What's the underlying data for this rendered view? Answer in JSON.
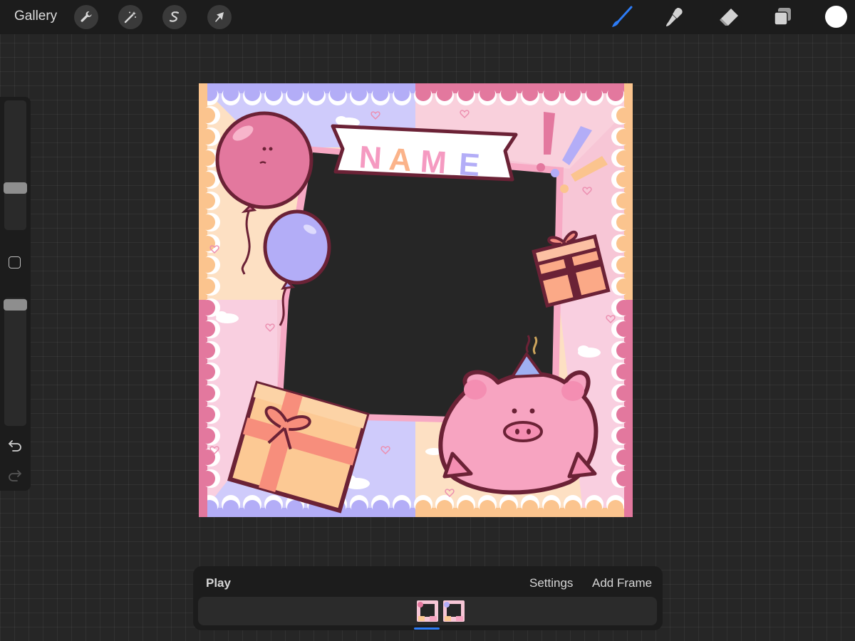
{
  "topbar": {
    "gallery_label": "Gallery",
    "left_tools": [
      "wrench-icon",
      "magic-wand-icon",
      "selection-s-icon",
      "transform-arrow-icon"
    ],
    "right_tools": [
      "brush-icon",
      "smudge-icon",
      "eraser-icon",
      "layers-icon"
    ],
    "active_tool": "brush-icon",
    "current_color": "#ffffff",
    "accent_color": "#2d7cf6"
  },
  "sidebar": {
    "brush_size_slider_level": 0.35,
    "opacity_slider_level": 0.94,
    "modify_button_icon": "square-icon",
    "undo_icon": "undo-arrow-icon",
    "redo_icon": "redo-arrow-icon"
  },
  "canvas": {
    "banner_text": "NAME",
    "colors": {
      "pink": "#f7c6d6",
      "lavender": "#c9c5fb",
      "peach": "#fde0c3",
      "dark_pink": "#e3789e",
      "outline": "#6b2236"
    }
  },
  "animation": {
    "play_label": "Play",
    "settings_label": "Settings",
    "add_frame_label": "Add Frame",
    "frames_count": 2,
    "selected_frame": 1
  }
}
